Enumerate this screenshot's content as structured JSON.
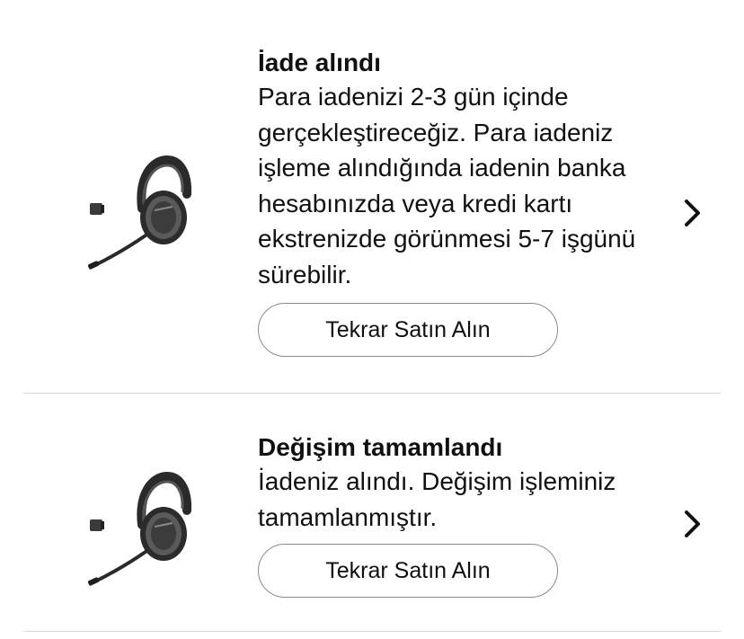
{
  "orders": [
    {
      "status_title": "İade alındı",
      "status_desc": "Para iadenizi 2-3 gün içinde gerçekleştireceğiz. Para iadeniz işleme alındığında iadenin banka hesabınızda veya kredi kartı ekstrenizde görünmesi 5-7 işgünü sürebilir.",
      "buy_again_label": "Tekrar Satın Alın",
      "product_image": "headset-product-image"
    },
    {
      "status_title": "Değişim tamamlandı",
      "status_desc": "İadeniz alındı. Değişim işleminiz tamamlanmıştır.",
      "buy_again_label": "Tekrar Satın Alın",
      "product_image": "headset-product-image"
    }
  ],
  "icons": {
    "chevron": "chevron-right-icon"
  },
  "colors": {
    "text": "#0f1111",
    "button_border": "#888c8c",
    "divider": "#d5d9d9"
  }
}
